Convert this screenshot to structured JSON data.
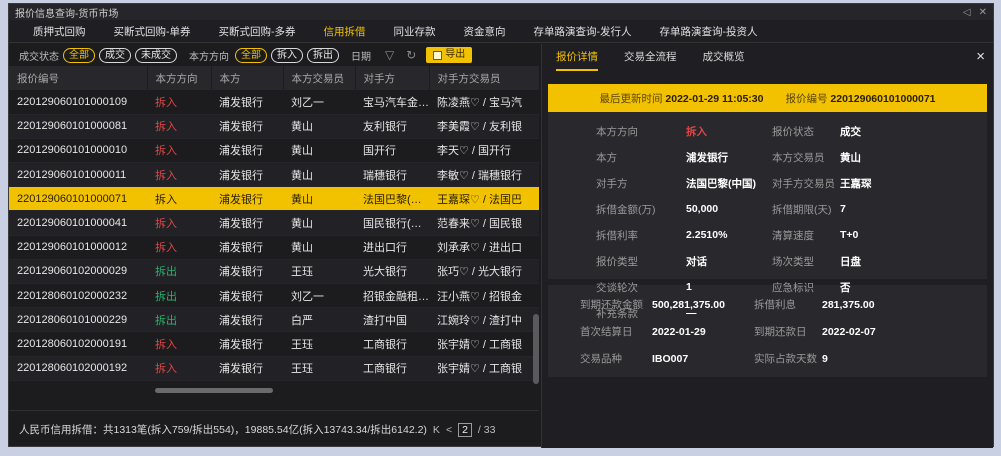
{
  "window": {
    "title": "报价信息查询-货币市场",
    "controls": [
      "◁",
      "✕"
    ]
  },
  "nav_tabs": [
    "质押式回购",
    "买断式回购-单券",
    "买断式回购-多券",
    "信用拆借",
    "同业存款",
    "资金意向",
    "存单路演查询-发行人",
    "存单路演查询-投资人"
  ],
  "active_nav": 3,
  "filters": {
    "status_label": "成交状态",
    "status_options": [
      "全部",
      "成交",
      "未成交"
    ],
    "direction_label": "本方方向",
    "direction_options": [
      "全部",
      "拆入",
      "拆出"
    ],
    "date_label": "日期",
    "export_label": "导出"
  },
  "table": {
    "columns": [
      "报价编号",
      "本方方向",
      "本方",
      "本方交易员",
      "对手方",
      "对手方交易员"
    ],
    "rows": [
      [
        "220129060101000109",
        "拆入",
        "浦发银行",
        "刘乙一",
        "宝马汽车金…",
        "陈凌燕♡ / 宝马汽"
      ],
      [
        "220129060101000081",
        "拆入",
        "浦发银行",
        "黄山",
        "友利银行",
        "李美霞♡ / 友利银"
      ],
      [
        "220129060101000010",
        "拆入",
        "浦发银行",
        "黄山",
        "国开行",
        "李天♡ / 国开行"
      ],
      [
        "220129060101000011",
        "拆入",
        "浦发银行",
        "黄山",
        "瑞穗银行",
        "李敏♡ / 瑞穗银行"
      ],
      [
        "220129060101000071",
        "拆入",
        "浦发银行",
        "黄山",
        "法国巴黎(…",
        "王嘉琛♡ / 法国巴"
      ],
      [
        "220129060101000041",
        "拆入",
        "浦发银行",
        "黄山",
        "国民银行(…",
        "范春来♡ / 国民银"
      ],
      [
        "220129060101000012",
        "拆入",
        "浦发银行",
        "黄山",
        "进出口行",
        "刘承承♡ / 进出口"
      ],
      [
        "220129060102000029",
        "拆出",
        "浦发银行",
        "王珏",
        "光大银行",
        "张巧♡ / 光大银行"
      ],
      [
        "220128060102000232",
        "拆出",
        "浦发银行",
        "刘乙一",
        "招银金融租…",
        "汪小燕♡ / 招银金"
      ],
      [
        "220128060101000229",
        "拆出",
        "浦发银行",
        "白严",
        "渣打中国",
        "江婉玲♡ / 渣打中"
      ],
      [
        "220128060102000191",
        "拆入",
        "浦发银行",
        "王珏",
        "工商银行",
        "张宇婧♡ / 工商银"
      ],
      [
        "220128060102000192",
        "拆入",
        "浦发银行",
        "王珏",
        "工商银行",
        "张宇婧♡ / 工商银"
      ]
    ],
    "selected_row": 4
  },
  "footer": {
    "summary": "人民币信用拆借：共1313笔(拆入759/拆出554)，19885.54亿(拆入13743.34/拆出6142.2)",
    "first": "K",
    "prev": "<",
    "page": "2",
    "total": "/ 33"
  },
  "detail": {
    "tabs": [
      "报价详情",
      "交易全流程",
      "成交概览"
    ],
    "active_tab": 0,
    "close": "×",
    "banner": {
      "update_label": "最后更新时间",
      "update_value": "2022-01-29 11:05:30",
      "id_label": "报价编号",
      "id_value": "220129060101000071"
    },
    "fields": [
      {
        "k1": "本方方向",
        "v1": "拆入",
        "k2": "报价状态",
        "v2": "成交"
      },
      {
        "k1": "本方",
        "v1": "浦发银行",
        "k2": "本方交易员",
        "v2": "黄山"
      },
      {
        "k1": "对手方",
        "v1": "法国巴黎(中国)",
        "k2": "对手方交易员",
        "v2": "王嘉琛"
      },
      {
        "k1": "拆借金额(万)",
        "v1": "50,000",
        "k2": "拆借期限(天)",
        "v2": "7"
      },
      {
        "k1": "拆借利率",
        "v1": "2.2510%",
        "k2": "清算速度",
        "v2": "T+0"
      },
      {
        "k1": "报价类型",
        "v1": "对话",
        "k2": "场次类型",
        "v2": "日盘"
      },
      {
        "k1": "交谈轮次",
        "v1": "1",
        "k2": "应急标识",
        "v2": "否"
      },
      {
        "k1": "补充条款",
        "v1": "—",
        "k2": "",
        "v2": ""
      }
    ],
    "fields2": [
      {
        "k1": "到期还款金额",
        "v1": "500,281,375.00",
        "k2": "拆借利息",
        "v2": "281,375.00"
      },
      {
        "k1": "首次结算日",
        "v1": "2022-01-29",
        "k2": "到期还款日",
        "v2": "2022-02-07"
      },
      {
        "k1": "交易品种",
        "v1": "IBO007",
        "k2": "实际占款天数",
        "v2": "9"
      }
    ]
  }
}
